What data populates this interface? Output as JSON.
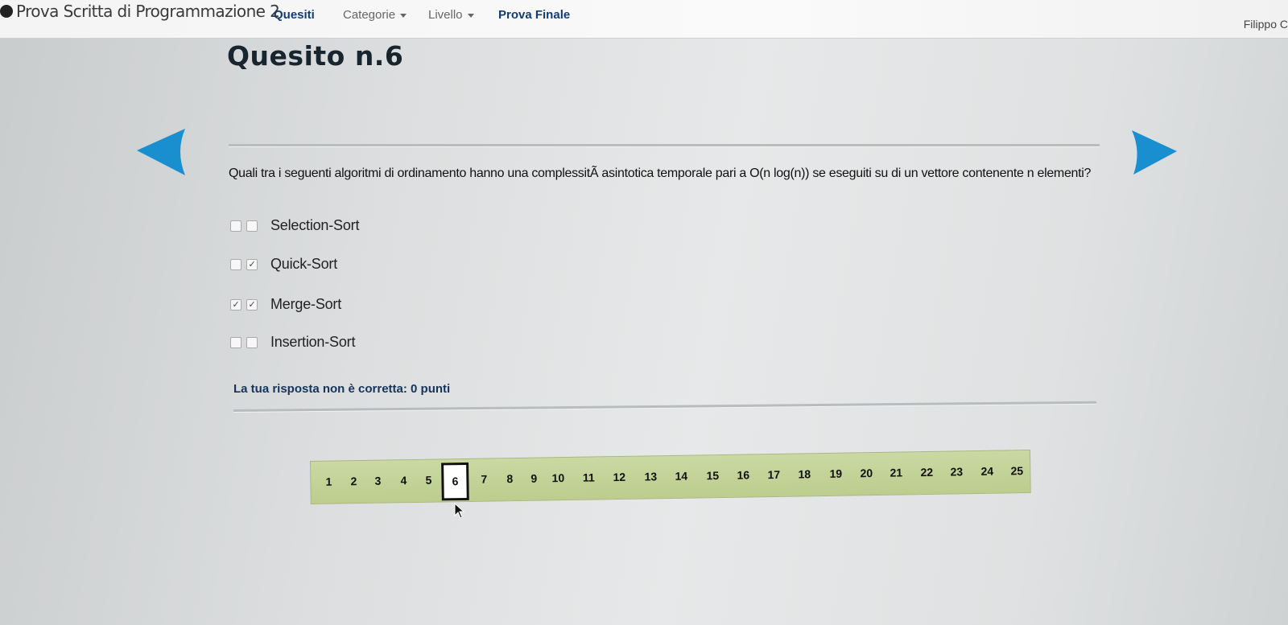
{
  "navbar": {
    "brand": "Prova Scritta di Programmazione 2",
    "quesiti": "Quesiti",
    "categorie": "Categorie",
    "livello": "Livello",
    "prova_finale": "Prova Finale",
    "user": "Filippo C"
  },
  "page": {
    "title": "Quesito n.6"
  },
  "question": {
    "text": "Quali tra i seguenti algoritmi di ordinamento hanno una complessitÃ  asintotica temporale pari a O(n log(n)) se eseguiti su di un vettore contenente n elementi?",
    "options": [
      {
        "label": "Selection-Sort",
        "check1": "",
        "check2": ""
      },
      {
        "label": "Quick-Sort",
        "check1": "",
        "check2": "✓"
      },
      {
        "label": "Merge-Sort",
        "check1": "✓",
        "check2": "✓"
      },
      {
        "label": "Insertion-Sort",
        "check1": "",
        "check2": ""
      }
    ],
    "result": "La tua risposta non è corretta: 0 punti"
  },
  "pager": {
    "pages": [
      "1",
      "2",
      "3",
      "4",
      "5",
      "6",
      "7",
      "8",
      "9",
      "10",
      "11",
      "12",
      "13",
      "14",
      "15",
      "16",
      "17",
      "18",
      "19",
      "20",
      "21",
      "22",
      "23",
      "24",
      "25"
    ],
    "current": "6"
  },
  "colors": {
    "accent_blue": "#1a8fd0",
    "title_navy": "#123d73",
    "pager_green": "#c4d498"
  },
  "icons": [
    "brand-icon",
    "prev-arrow-icon",
    "next-arrow-icon",
    "checkbox-icon",
    "mouse-cursor-icon"
  ]
}
